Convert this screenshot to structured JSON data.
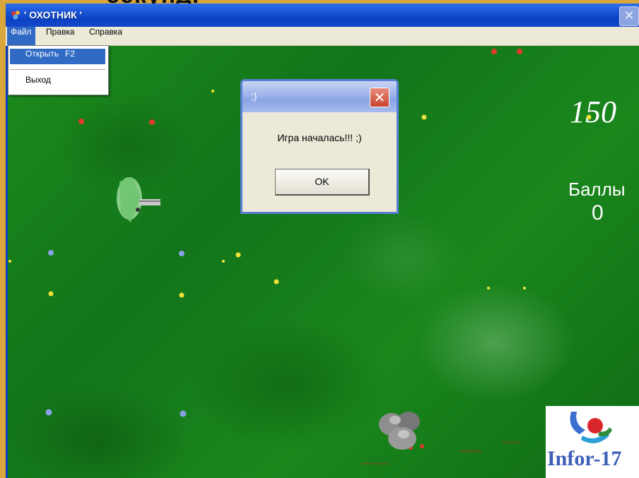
{
  "slide": {
    "caption": "секунд."
  },
  "window": {
    "title": "' ОХОТНИК '",
    "close_glyph": "✕",
    "app_icon": "hunter-app-icon"
  },
  "menu": {
    "items": [
      {
        "label": "Файл",
        "active": true
      },
      {
        "label": "Правка",
        "active": false
      },
      {
        "label": "Справка",
        "active": false
      }
    ],
    "file_dropdown": [
      {
        "label": "Открыть",
        "shortcut": "F2",
        "highlighted": true
      },
      {
        "label": "Выход",
        "shortcut": "",
        "highlighted": false
      }
    ]
  },
  "hud": {
    "score": "150",
    "points_label": "Баллы",
    "points_value": "0"
  },
  "dialog": {
    "title": ";)",
    "close_glyph": "✕",
    "message": "Игра началась!!! ;)",
    "ok_label": "OK"
  },
  "logo": {
    "text": "Infor-17"
  },
  "colors": {
    "grass": "#1a861c",
    "titlebar": "#0b41c4",
    "menu_highlight": "#316ac5",
    "dialog_close": "#c9432e"
  }
}
